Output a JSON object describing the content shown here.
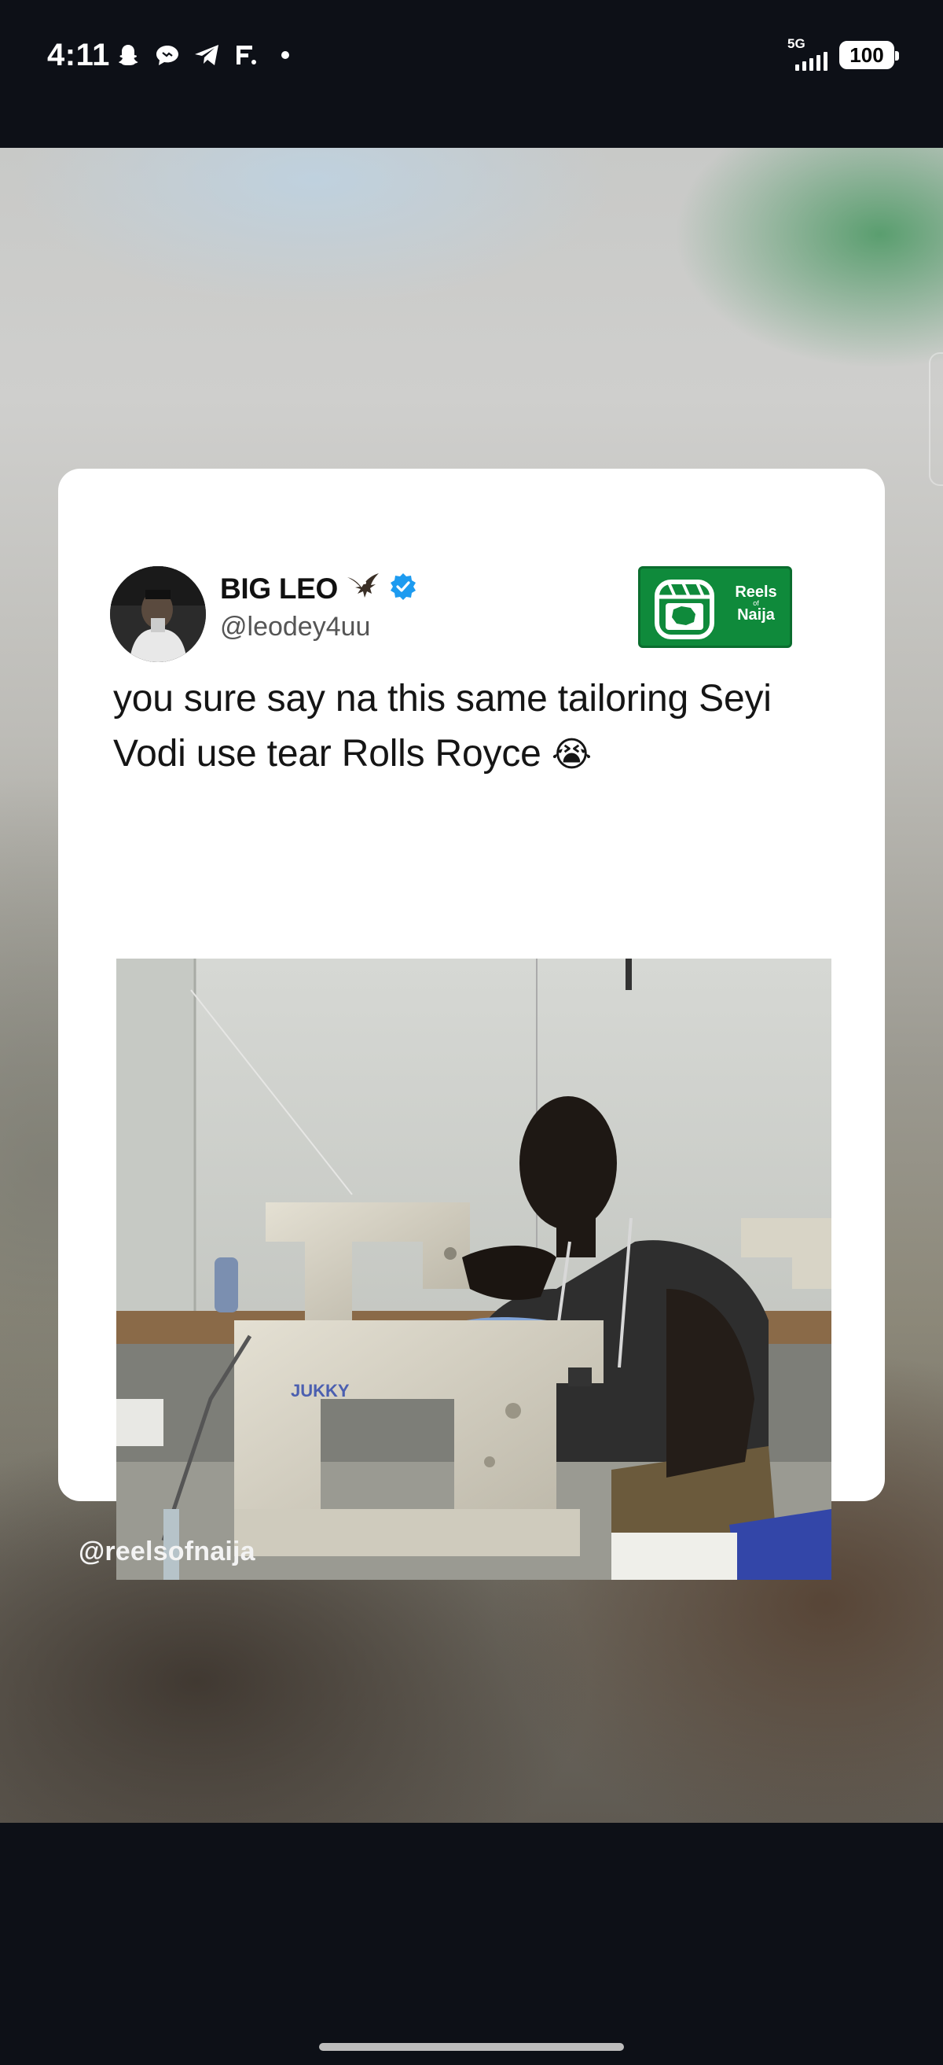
{
  "status_bar": {
    "time": "4:11",
    "notification_icons": [
      "snapchat-icon",
      "chat-bubble-icon",
      "telegram-icon",
      "f-app-icon",
      "dot-icon"
    ],
    "network_label": "5G",
    "battery": "100"
  },
  "post": {
    "display_name": "BIG LEO",
    "name_emoji": "eagle-icon",
    "verified": true,
    "handle": "@leodey4uu",
    "text": "you sure say na this same tailoring Seyi Vodi use tear Rolls Royce",
    "text_emoji": "😭",
    "brand": {
      "line1": "Reels",
      "line2": "of",
      "line3": "Naija",
      "color": "#0f8a3b"
    },
    "photo_text": "JUKKY"
  },
  "watermark": "@reelsofnaija",
  "colors": {
    "background": "#0d1017",
    "card": "#ffffff",
    "verified": "#1d9bf0",
    "brand_green": "#0f8a3b"
  }
}
